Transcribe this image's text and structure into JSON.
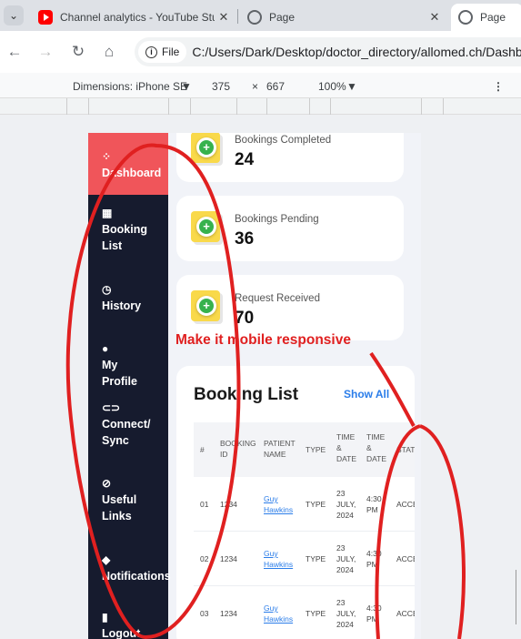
{
  "browser": {
    "tabs": [
      {
        "title": "Channel analytics - YouTube Stu",
        "close": "✕",
        "icon": "youtube-icon"
      },
      {
        "title": "Page",
        "close": "✕",
        "icon": "globe-icon"
      },
      {
        "title": "Page",
        "icon": "globe-icon"
      }
    ],
    "chip_label": "File",
    "url": "C:/Users/Dark/Desktop/doctor_directory/allomed.ch/Dashbo",
    "device": {
      "dimensions": "Dimensions: iPhone SE",
      "arrow": "▼",
      "width": "375",
      "times": "×",
      "height": "667",
      "zoom": "100%",
      "zoom_arrow": "▼"
    }
  },
  "sidebar": {
    "items": [
      {
        "label": "Dashboard",
        "icon": "grid-icon",
        "glyph": "⁘"
      },
      {
        "label": "Booking List",
        "icon": "calendar-icon",
        "glyph": "▦"
      },
      {
        "label": "History",
        "icon": "clock-icon",
        "glyph": "◷"
      },
      {
        "label": "My Profile",
        "icon": "user-icon",
        "glyph": "●"
      },
      {
        "label": "Connect/ Sync",
        "icon": "link-icon",
        "glyph": "⊂⊃"
      },
      {
        "label": "Useful Links",
        "icon": "link-circle-icon",
        "glyph": "⊘"
      },
      {
        "label": "Notifications",
        "icon": "bell-icon",
        "glyph": "◆"
      },
      {
        "label": "Logout",
        "icon": "logout-icon",
        "glyph": "▮"
      }
    ]
  },
  "stats": [
    {
      "label": "Bookings Completed",
      "value": "24"
    },
    {
      "label": "Bookings Pending",
      "value": "36"
    },
    {
      "label": "Request Received",
      "value": "70"
    }
  ],
  "booking_list": {
    "title": "Booking List",
    "show_all": "Show All",
    "headers": [
      "#",
      "BOOKING ID",
      "PATIENT NAME",
      "TYPE",
      "TIME & DATE",
      "TIME & DATE",
      "STATUS"
    ],
    "rows": [
      {
        "num": "01",
        "id": "1234",
        "patient": "Guy Hawkins",
        "type": "TYPE",
        "date": "23 JULY, 2024",
        "time": "4:30 PM",
        "status": "ACCEPTED"
      },
      {
        "num": "02",
        "id": "1234",
        "patient": "Guy Hawkins",
        "type": "TYPE",
        "date": "23 JULY, 2024",
        "time": "4:30 PM",
        "status": "ACCEPTED"
      },
      {
        "num": "03",
        "id": "1234",
        "patient": "Guy Hawkins",
        "type": "TYPE",
        "date": "23 JULY, 2024",
        "time": "4:30 PM",
        "status": "ACCEPTED"
      }
    ]
  },
  "annotation": {
    "text": "Make it mobile responsive",
    "color": "#e02020"
  },
  "colors": {
    "sidebar_bg": "#161b2e",
    "sidebar_active": "#f0555a",
    "link": "#2b7de9"
  }
}
